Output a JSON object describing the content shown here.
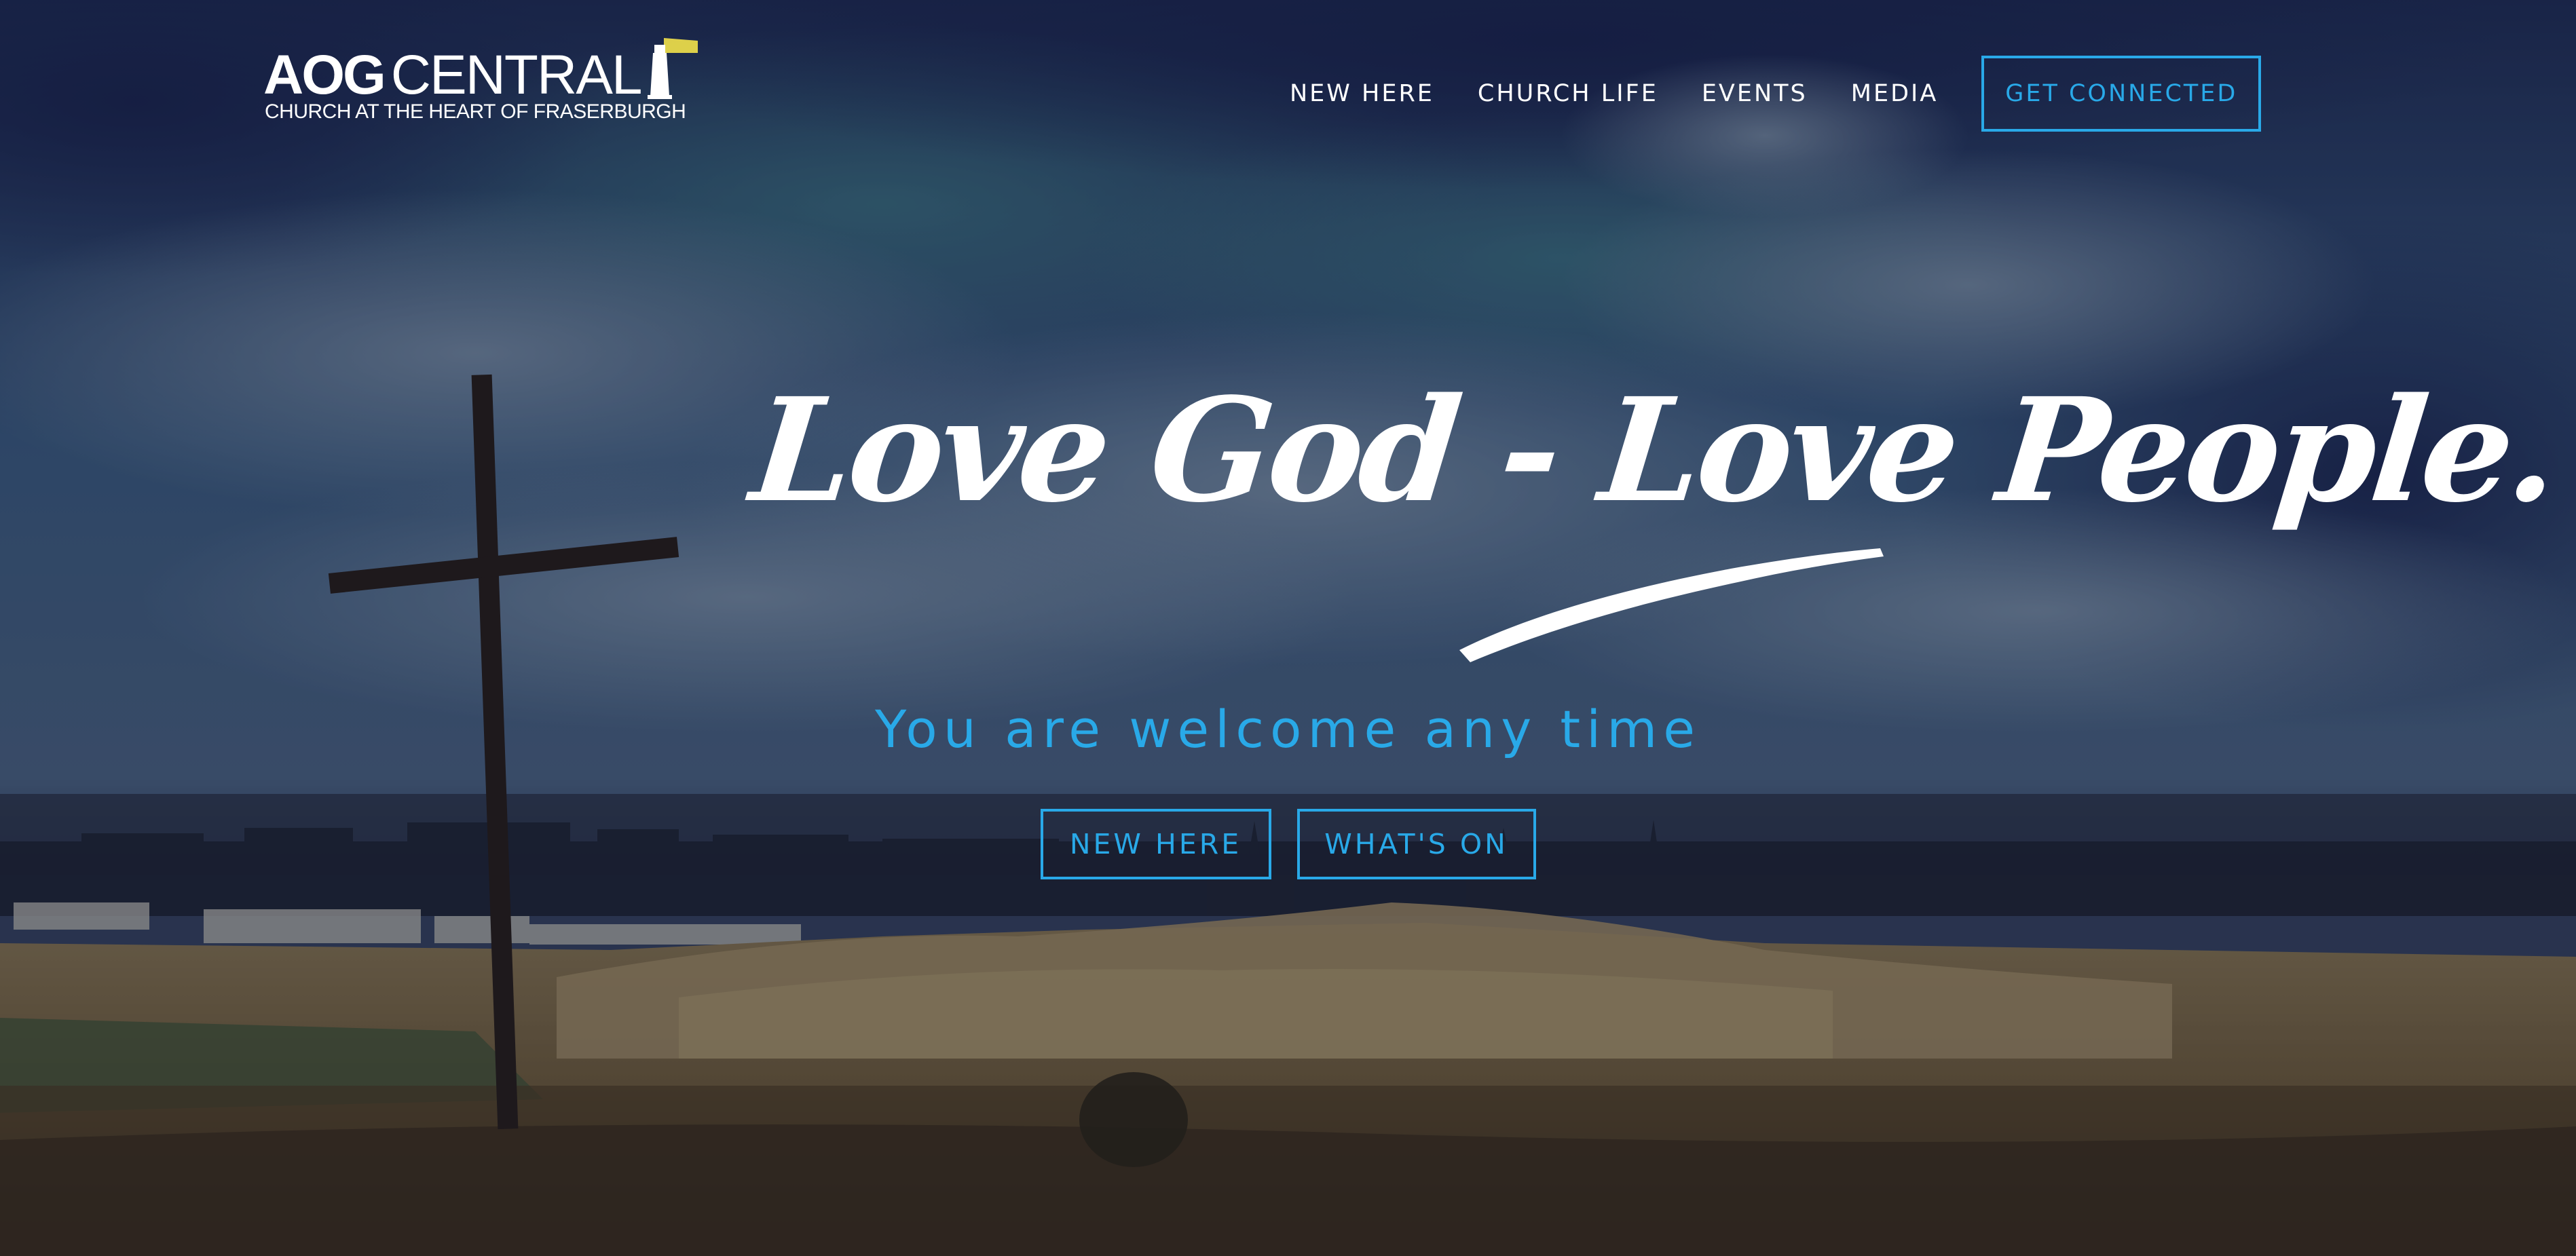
{
  "header": {
    "logo": {
      "bold": "AOG",
      "light": "CENTRAL",
      "subtitle": "CHURCH AT THE HEART OF FRASERBURGH"
    },
    "nav": [
      {
        "label": "NEW HERE"
      },
      {
        "label": "CHURCH LIFE"
      },
      {
        "label": "EVENTS"
      },
      {
        "label": "MEDIA"
      }
    ],
    "cta": {
      "label": "GET CONNECTED"
    }
  },
  "hero": {
    "tagline": "Love God - Love People.",
    "welcome": "You are welcome any time",
    "buttons": [
      {
        "label": "NEW HERE"
      },
      {
        "label": "WHAT'S ON"
      }
    ],
    "background_icon": "landscape-with-cross-image"
  },
  "colors": {
    "accent": "#29a9e8",
    "text": "#ffffff",
    "sky": "#2c3f66",
    "field": "#7d6a45"
  }
}
